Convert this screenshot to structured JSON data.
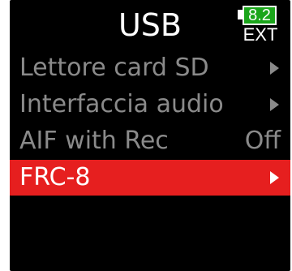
{
  "header": {
    "title": "USB",
    "battery_value": "8.2",
    "power_source": "EXT"
  },
  "menu": {
    "items": [
      {
        "label": "Lettore card SD",
        "value": "",
        "has_arrow": true,
        "selected": false
      },
      {
        "label": "Interfaccia audio",
        "value": "",
        "has_arrow": true,
        "selected": false
      },
      {
        "label": "AIF with Rec",
        "value": "Off",
        "has_arrow": false,
        "selected": false
      },
      {
        "label": "FRC-8",
        "value": "",
        "has_arrow": true,
        "selected": true
      }
    ]
  },
  "colors": {
    "background": "#000000",
    "text": "#ffffff",
    "dim_text": "#8a8a8a",
    "selection": "#e61f1f",
    "battery": "#1aa51a"
  },
  "icons": {
    "battery": "battery-icon",
    "submenu_arrow": "chevron-right-icon"
  }
}
